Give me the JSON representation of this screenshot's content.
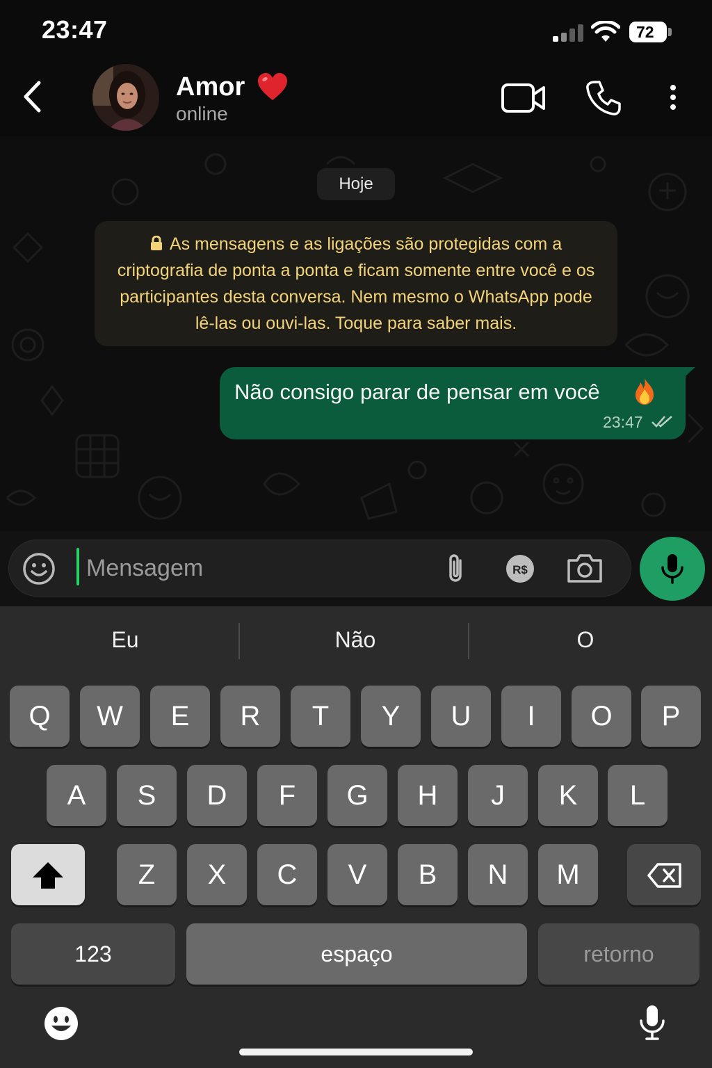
{
  "status_bar": {
    "time": "23:47",
    "battery": "72",
    "signal_icon": "signal-icon",
    "wifi_icon": "wifi-icon"
  },
  "header": {
    "contact_name": "Amor",
    "contact_status": "online",
    "name_emoji": "red-heart-icon",
    "icons": [
      "back-icon",
      "video-call-icon",
      "voice-call-icon",
      "more-options-icon"
    ]
  },
  "chat": {
    "date_chip": "Hoje",
    "encryption_notice": "As mensagens e as ligações são protegidas com a criptografia de ponta a ponta e ficam somente entre você e os participantes desta conversa. Nem mesmo o WhatsApp pode lê-las ou ouvi-las. Toque para saber mais.",
    "messages": [
      {
        "direction": "outgoing",
        "text": "Não consigo parar de pensar em você",
        "emoji": "fire-icon",
        "time": "23:47",
        "status": "read"
      }
    ]
  },
  "composer": {
    "placeholder": "Mensagem",
    "value": "",
    "icons": [
      "emoji-icon",
      "paperclip-icon",
      "pix-icon",
      "camera-icon",
      "microphone-icon"
    ]
  },
  "keyboard": {
    "suggestions": [
      "Eu",
      "Não",
      "O"
    ],
    "row1": [
      "Q",
      "W",
      "E",
      "R",
      "T",
      "Y",
      "U",
      "I",
      "O",
      "P"
    ],
    "row2": [
      "A",
      "S",
      "D",
      "F",
      "G",
      "H",
      "J",
      "K",
      "L"
    ],
    "row3": [
      "Z",
      "X",
      "C",
      "V",
      "B",
      "N",
      "M"
    ],
    "numbers_key": "123",
    "space_key": "espaço",
    "return_key": "retorno"
  },
  "colors": {
    "accent_green": "#1e9e63",
    "bubble_out": "#0a5c3c",
    "notice_text": "#f2d37a",
    "background": "#0b0b0b"
  }
}
